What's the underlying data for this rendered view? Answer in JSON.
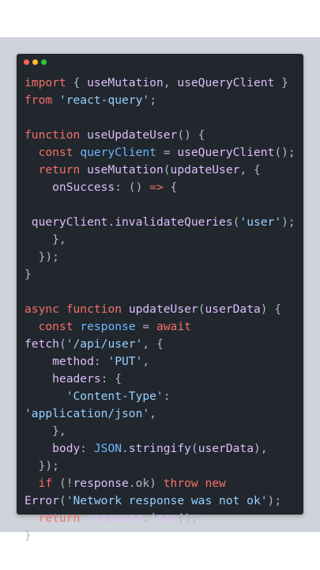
{
  "editor": {
    "window_controls": [
      "close-dot",
      "minimize-dot",
      "zoom-dot"
    ],
    "code_lines": [
      [
        {
          "t": "import",
          "c": "kw"
        },
        {
          "t": " { ",
          "c": "var"
        },
        {
          "t": "useMutation",
          "c": "fn"
        },
        {
          "t": ", ",
          "c": "var"
        },
        {
          "t": "useQueryClient",
          "c": "fn"
        },
        {
          "t": " }",
          "c": "var"
        }
      ],
      [
        {
          "t": "from",
          "c": "kw"
        },
        {
          "t": " ",
          "c": "var"
        },
        {
          "t": "'react-query'",
          "c": "str"
        },
        {
          "t": ";",
          "c": "var"
        }
      ],
      [],
      [
        {
          "t": "function",
          "c": "kw"
        },
        {
          "t": " ",
          "c": "var"
        },
        {
          "t": "useUpdateUser",
          "c": "fn"
        },
        {
          "t": "() {",
          "c": "var"
        }
      ],
      [
        {
          "t": "  const",
          "c": "kw"
        },
        {
          "t": " ",
          "c": "var"
        },
        {
          "t": "queryClient",
          "c": "pr"
        },
        {
          "t": " = ",
          "c": "var"
        },
        {
          "t": "useQueryClient",
          "c": "fn"
        },
        {
          "t": "();",
          "c": "var"
        }
      ],
      [
        {
          "t": "  return",
          "c": "kw"
        },
        {
          "t": " ",
          "c": "var"
        },
        {
          "t": "useMutation",
          "c": "fn"
        },
        {
          "t": "(",
          "c": "var"
        },
        {
          "t": "updateUser",
          "c": "fn"
        },
        {
          "t": ", {",
          "c": "var"
        }
      ],
      [
        {
          "t": "    onSuccess",
          "c": "fn"
        },
        {
          "t": ": () ",
          "c": "var"
        },
        {
          "t": "=>",
          "c": "kw"
        },
        {
          "t": " {",
          "c": "var"
        }
      ],
      [],
      [
        {
          "t": " queryClient",
          "c": "fn"
        },
        {
          "t": ".",
          "c": "var"
        },
        {
          "t": "invalidateQueries",
          "c": "fn"
        },
        {
          "t": "(",
          "c": "var"
        },
        {
          "t": "'user'",
          "c": "str"
        },
        {
          "t": ");",
          "c": "var"
        }
      ],
      [
        {
          "t": "    },",
          "c": "var"
        }
      ],
      [
        {
          "t": "  });",
          "c": "var"
        }
      ],
      [
        {
          "t": "}",
          "c": "var"
        }
      ],
      [],
      [
        {
          "t": "async",
          "c": "kw"
        },
        {
          "t": " ",
          "c": "var"
        },
        {
          "t": "function",
          "c": "kw"
        },
        {
          "t": " ",
          "c": "var"
        },
        {
          "t": "updateUser",
          "c": "fn"
        },
        {
          "t": "(",
          "c": "var"
        },
        {
          "t": "userData",
          "c": "fn"
        },
        {
          "t": ") {",
          "c": "var"
        }
      ],
      [
        {
          "t": "  const",
          "c": "kw"
        },
        {
          "t": " ",
          "c": "var"
        },
        {
          "t": "response",
          "c": "pr"
        },
        {
          "t": " = ",
          "c": "var"
        },
        {
          "t": "await",
          "c": "kw"
        }
      ],
      [
        {
          "t": "fetch",
          "c": "fn"
        },
        {
          "t": "(",
          "c": "var"
        },
        {
          "t": "'/api/user'",
          "c": "str"
        },
        {
          "t": ", {",
          "c": "var"
        }
      ],
      [
        {
          "t": "    method",
          "c": "fn"
        },
        {
          "t": ": ",
          "c": "var"
        },
        {
          "t": "'PUT'",
          "c": "str"
        },
        {
          "t": ",",
          "c": "var"
        }
      ],
      [
        {
          "t": "    headers",
          "c": "fn"
        },
        {
          "t": ": {",
          "c": "var"
        }
      ],
      [
        {
          "t": "      'Content-Type'",
          "c": "str"
        },
        {
          "t": ":",
          "c": "var"
        }
      ],
      [
        {
          "t": "'application/json'",
          "c": "str"
        },
        {
          "t": ",",
          "c": "var"
        }
      ],
      [
        {
          "t": "    },",
          "c": "var"
        }
      ],
      [
        {
          "t": "    body",
          "c": "fn"
        },
        {
          "t": ": ",
          "c": "var"
        },
        {
          "t": "JSON",
          "c": "pr"
        },
        {
          "t": ".",
          "c": "var"
        },
        {
          "t": "stringify",
          "c": "fn"
        },
        {
          "t": "(",
          "c": "var"
        },
        {
          "t": "userData",
          "c": "fn"
        },
        {
          "t": "),",
          "c": "var"
        }
      ],
      [
        {
          "t": "  });",
          "c": "var"
        }
      ],
      [
        {
          "t": "  if",
          "c": "kw"
        },
        {
          "t": " (!",
          "c": "var"
        },
        {
          "t": "response",
          "c": "fn"
        },
        {
          "t": ".ok) ",
          "c": "var"
        },
        {
          "t": "throw",
          "c": "kw"
        },
        {
          "t": " ",
          "c": "var"
        },
        {
          "t": "new",
          "c": "kw"
        }
      ],
      [
        {
          "t": "Error",
          "c": "fn"
        },
        {
          "t": "(",
          "c": "var"
        },
        {
          "t": "'Network response was not ok'",
          "c": "str"
        },
        {
          "t": ");",
          "c": "var"
        }
      ],
      [
        {
          "t": "  return",
          "c": "kw"
        },
        {
          "t": " ",
          "c": "var"
        },
        {
          "t": "response",
          "c": "fn"
        },
        {
          "t": ".",
          "c": "var"
        },
        {
          "t": "json",
          "c": "fn"
        },
        {
          "t": "();",
          "c": "var"
        }
      ],
      [
        {
          "t": "}",
          "c": "var"
        }
      ]
    ]
  }
}
